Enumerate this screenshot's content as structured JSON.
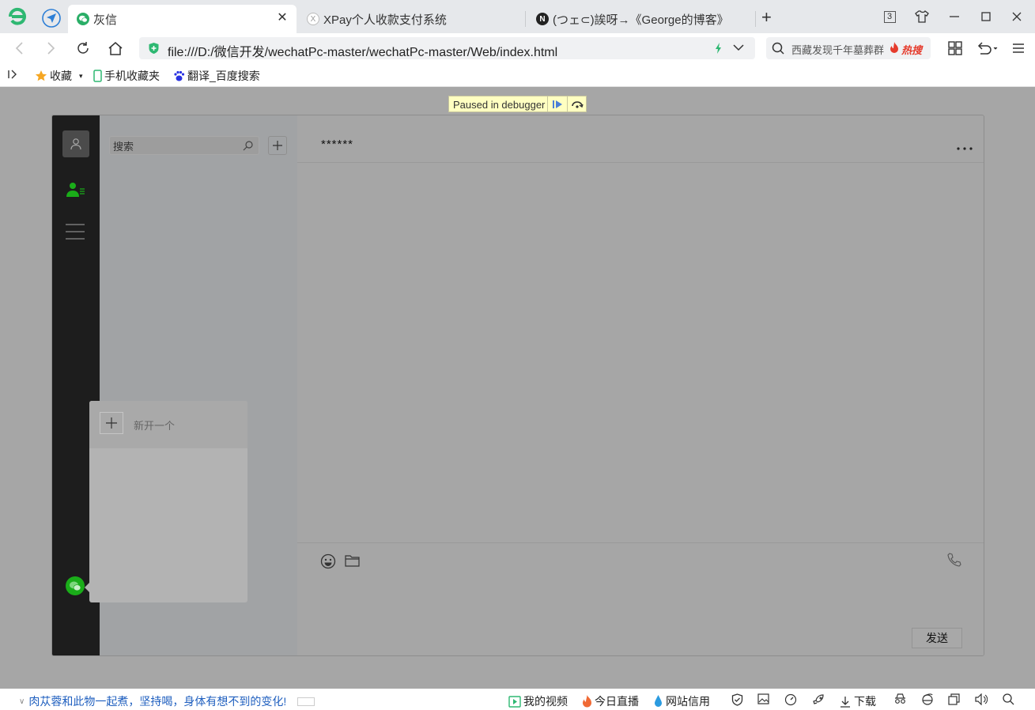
{
  "browser": {
    "tabs": [
      {
        "label": "灰信",
        "active": true
      },
      {
        "label": "XPay个人收款支付系统",
        "active": false
      },
      {
        "label": "(つェ⊂)誒呀→《George的博客》",
        "active": false
      }
    ],
    "new_tab_label": "+",
    "tab_count_badge": "3",
    "address": "file:///D:/微信开发/wechatPc-master/wechatPc-master/Web/index.html",
    "search_suggestion": "西藏发现千年墓葬群",
    "search_hot_label": "热搜",
    "bookmarks": [
      {
        "label": "收藏",
        "icon": "star-icon"
      },
      {
        "label": "手机收藏夹",
        "icon": "phone-icon"
      },
      {
        "label": "翻译_百度搜索",
        "icon": "baidu-paw-icon"
      }
    ]
  },
  "debugger": {
    "status": "Paused in debugger"
  },
  "app": {
    "search_placeholder": "搜索",
    "chat_title": "******",
    "more_label": "...",
    "send_label": "发送",
    "popup_new_label": "新开一个"
  },
  "status_bar": {
    "news": "肉苁蓉和此物一起煮，坚持喝，身体有想不到的变化!",
    "items": [
      {
        "label": "我的视频",
        "icon": "video-icon"
      },
      {
        "label": "今日直播",
        "icon": "flame-icon"
      },
      {
        "label": "网站信用",
        "icon": "drop-icon"
      }
    ],
    "download_label": "下载"
  },
  "colors": {
    "wechat_green": "#2aae67",
    "nav_dark": "#1d1d1d",
    "overlay_gray": "#a6a6a6",
    "hot_red": "#e53b2c",
    "debugger_yellow": "#ffffc1"
  }
}
